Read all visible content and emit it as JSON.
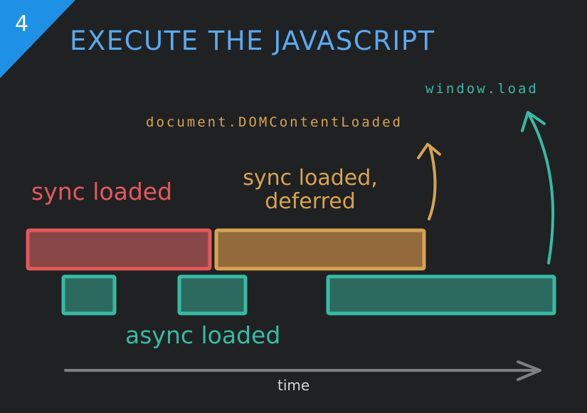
{
  "step_number": "4",
  "title": "EXECUTE THE JAVASCRIPT",
  "events": {
    "dom_content_loaded": "document.DOMContentLoaded",
    "window_load": "window.load"
  },
  "categories": {
    "sync": "sync loaded",
    "sync_deferred_line1": "sync loaded,",
    "sync_deferred_line2": "deferred",
    "async": "async loaded"
  },
  "axis": {
    "label": "time"
  },
  "colors": {
    "background": "#202123",
    "badge": "#1e90e6",
    "title": "#5aaaf0",
    "sync": "#e4595b",
    "sync_fill": "#8a4747",
    "deferred": "#d6a452",
    "deferred_fill": "#936a3c",
    "async": "#36bba4",
    "async_fill": "#2c6a60",
    "axis": "#7f7f7f"
  },
  "icons": {
    "dom_arrow": "curved-up-arrow",
    "load_arrow": "curved-up-arrow",
    "time_arrow": "right-arrow"
  }
}
